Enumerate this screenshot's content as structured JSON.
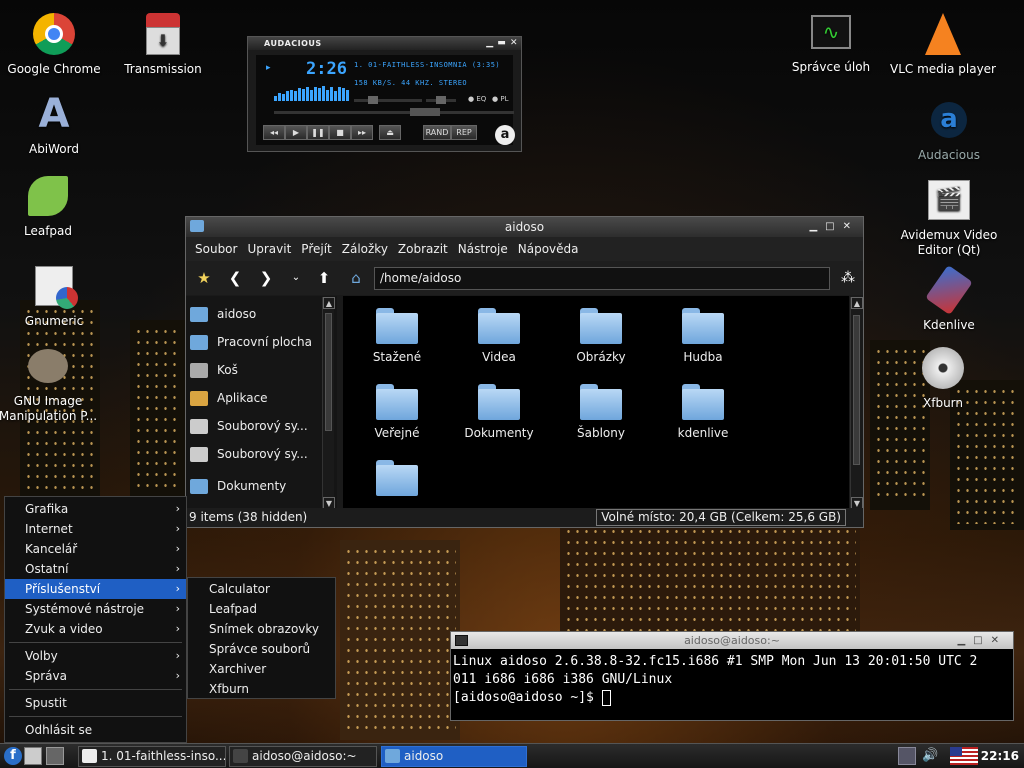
{
  "desktop_icons": [
    {
      "label": "Google Chrome",
      "icon": "chrome-icon"
    },
    {
      "label": "Transmission",
      "icon": "transmission-icon"
    },
    {
      "label": "AbiWord",
      "icon": "abiword-icon"
    },
    {
      "label": "Leafpad",
      "icon": "leafpad-icon"
    },
    {
      "label": "Gnumeric",
      "icon": "gnumeric-icon"
    },
    {
      "label": "GNU Image Manipulation P...",
      "icon": "gimp-icon"
    },
    {
      "label": "Správce úloh",
      "icon": "task-manager-icon"
    },
    {
      "label": "VLC media player",
      "icon": "vlc-icon"
    },
    {
      "label": "Audacious",
      "icon": "audacious-icon"
    },
    {
      "label": "Avidemux Video Editor (Qt)",
      "icon": "avidemux-icon"
    },
    {
      "label": "Kdenlive",
      "icon": "kdenlive-icon"
    },
    {
      "label": "Xfburn",
      "icon": "xfburn-icon"
    }
  ],
  "audacious": {
    "title": "AUDACIOUS",
    "time": "2:26",
    "track": "1. 01-FAITHLESS-INSOMNIA (3:35)",
    "info": "158 KB/S. 44 KHZ. STEREO",
    "eq_label": "EQ",
    "pl_label": "PL",
    "rand_label": "RAND",
    "rep_label": "REP",
    "spectrum": [
      0.3,
      0.5,
      0.45,
      0.6,
      0.7,
      0.65,
      0.8,
      0.75,
      0.9,
      0.7,
      0.85,
      0.8,
      0.95,
      0.7,
      0.9,
      0.6,
      0.85,
      0.8,
      0.7
    ]
  },
  "file_manager": {
    "title": "aidoso",
    "menu": [
      "Soubor",
      "Upravit",
      "Přejít",
      "Záložky",
      "Zobrazit",
      "Nástroje",
      "Nápověda"
    ],
    "path": "/home/aidoso",
    "sidebar": [
      {
        "label": "aidoso",
        "color": "#6fa8dc"
      },
      {
        "label": "Pracovní plocha",
        "color": "#6fa8dc"
      },
      {
        "label": "Koš",
        "color": "#aaaaaa"
      },
      {
        "label": "Aplikace",
        "color": "#d9a441"
      },
      {
        "label": "Souborový sy...",
        "color": "#cccccc"
      },
      {
        "label": "Souborový sy...",
        "color": "#cccccc"
      },
      {
        "label": "Dokumenty",
        "color": "#6fa8dc"
      }
    ],
    "folders": [
      "Stažené",
      "Videa",
      "Obrázky",
      "Hudba",
      "Veřejné",
      "Dokumenty",
      "Šablony",
      "kdenlive",
      ""
    ],
    "status_items": "9 items (38 hidden)",
    "status_free": "Volné místo: 20,4 GB (Celkem: 25,6 GB)"
  },
  "terminal": {
    "title": "aidoso@aidoso:~",
    "lines": [
      "Linux aidoso 2.6.38.8-32.fc15.i686 #1 SMP Mon Jun 13 20:01:50 UTC 2",
      "011 i686 i686 i386 GNU/Linux",
      "[aidoso@aidoso ~]$ "
    ]
  },
  "start_menu": {
    "items": [
      {
        "label": "Grafika",
        "submenu": true
      },
      {
        "label": "Internet",
        "submenu": true
      },
      {
        "label": "Kancelář",
        "submenu": true
      },
      {
        "label": "Ostatní",
        "submenu": true
      },
      {
        "label": "Příslušenství",
        "submenu": true,
        "selected": true
      },
      {
        "label": "Systémové nástroje",
        "submenu": true
      },
      {
        "label": "Zvuk a video",
        "submenu": true
      }
    ],
    "items2": [
      {
        "label": "Volby",
        "submenu": true
      },
      {
        "label": "Správa",
        "submenu": true
      }
    ],
    "run": "Spustit",
    "logout": "Odhlásit se",
    "arrow": "›"
  },
  "submenu": [
    "Calculator",
    "Leafpad",
    "Snímek obrazovky",
    "Správce souborů",
    "Xarchiver",
    "Xfburn"
  ],
  "taskbar": {
    "tasks": [
      {
        "label": "1. 01-faithless-inso...",
        "active": false
      },
      {
        "label": "aidoso@aidoso:~",
        "active": false
      },
      {
        "label": "aidoso",
        "active": true
      }
    ],
    "clock": "22:16"
  }
}
